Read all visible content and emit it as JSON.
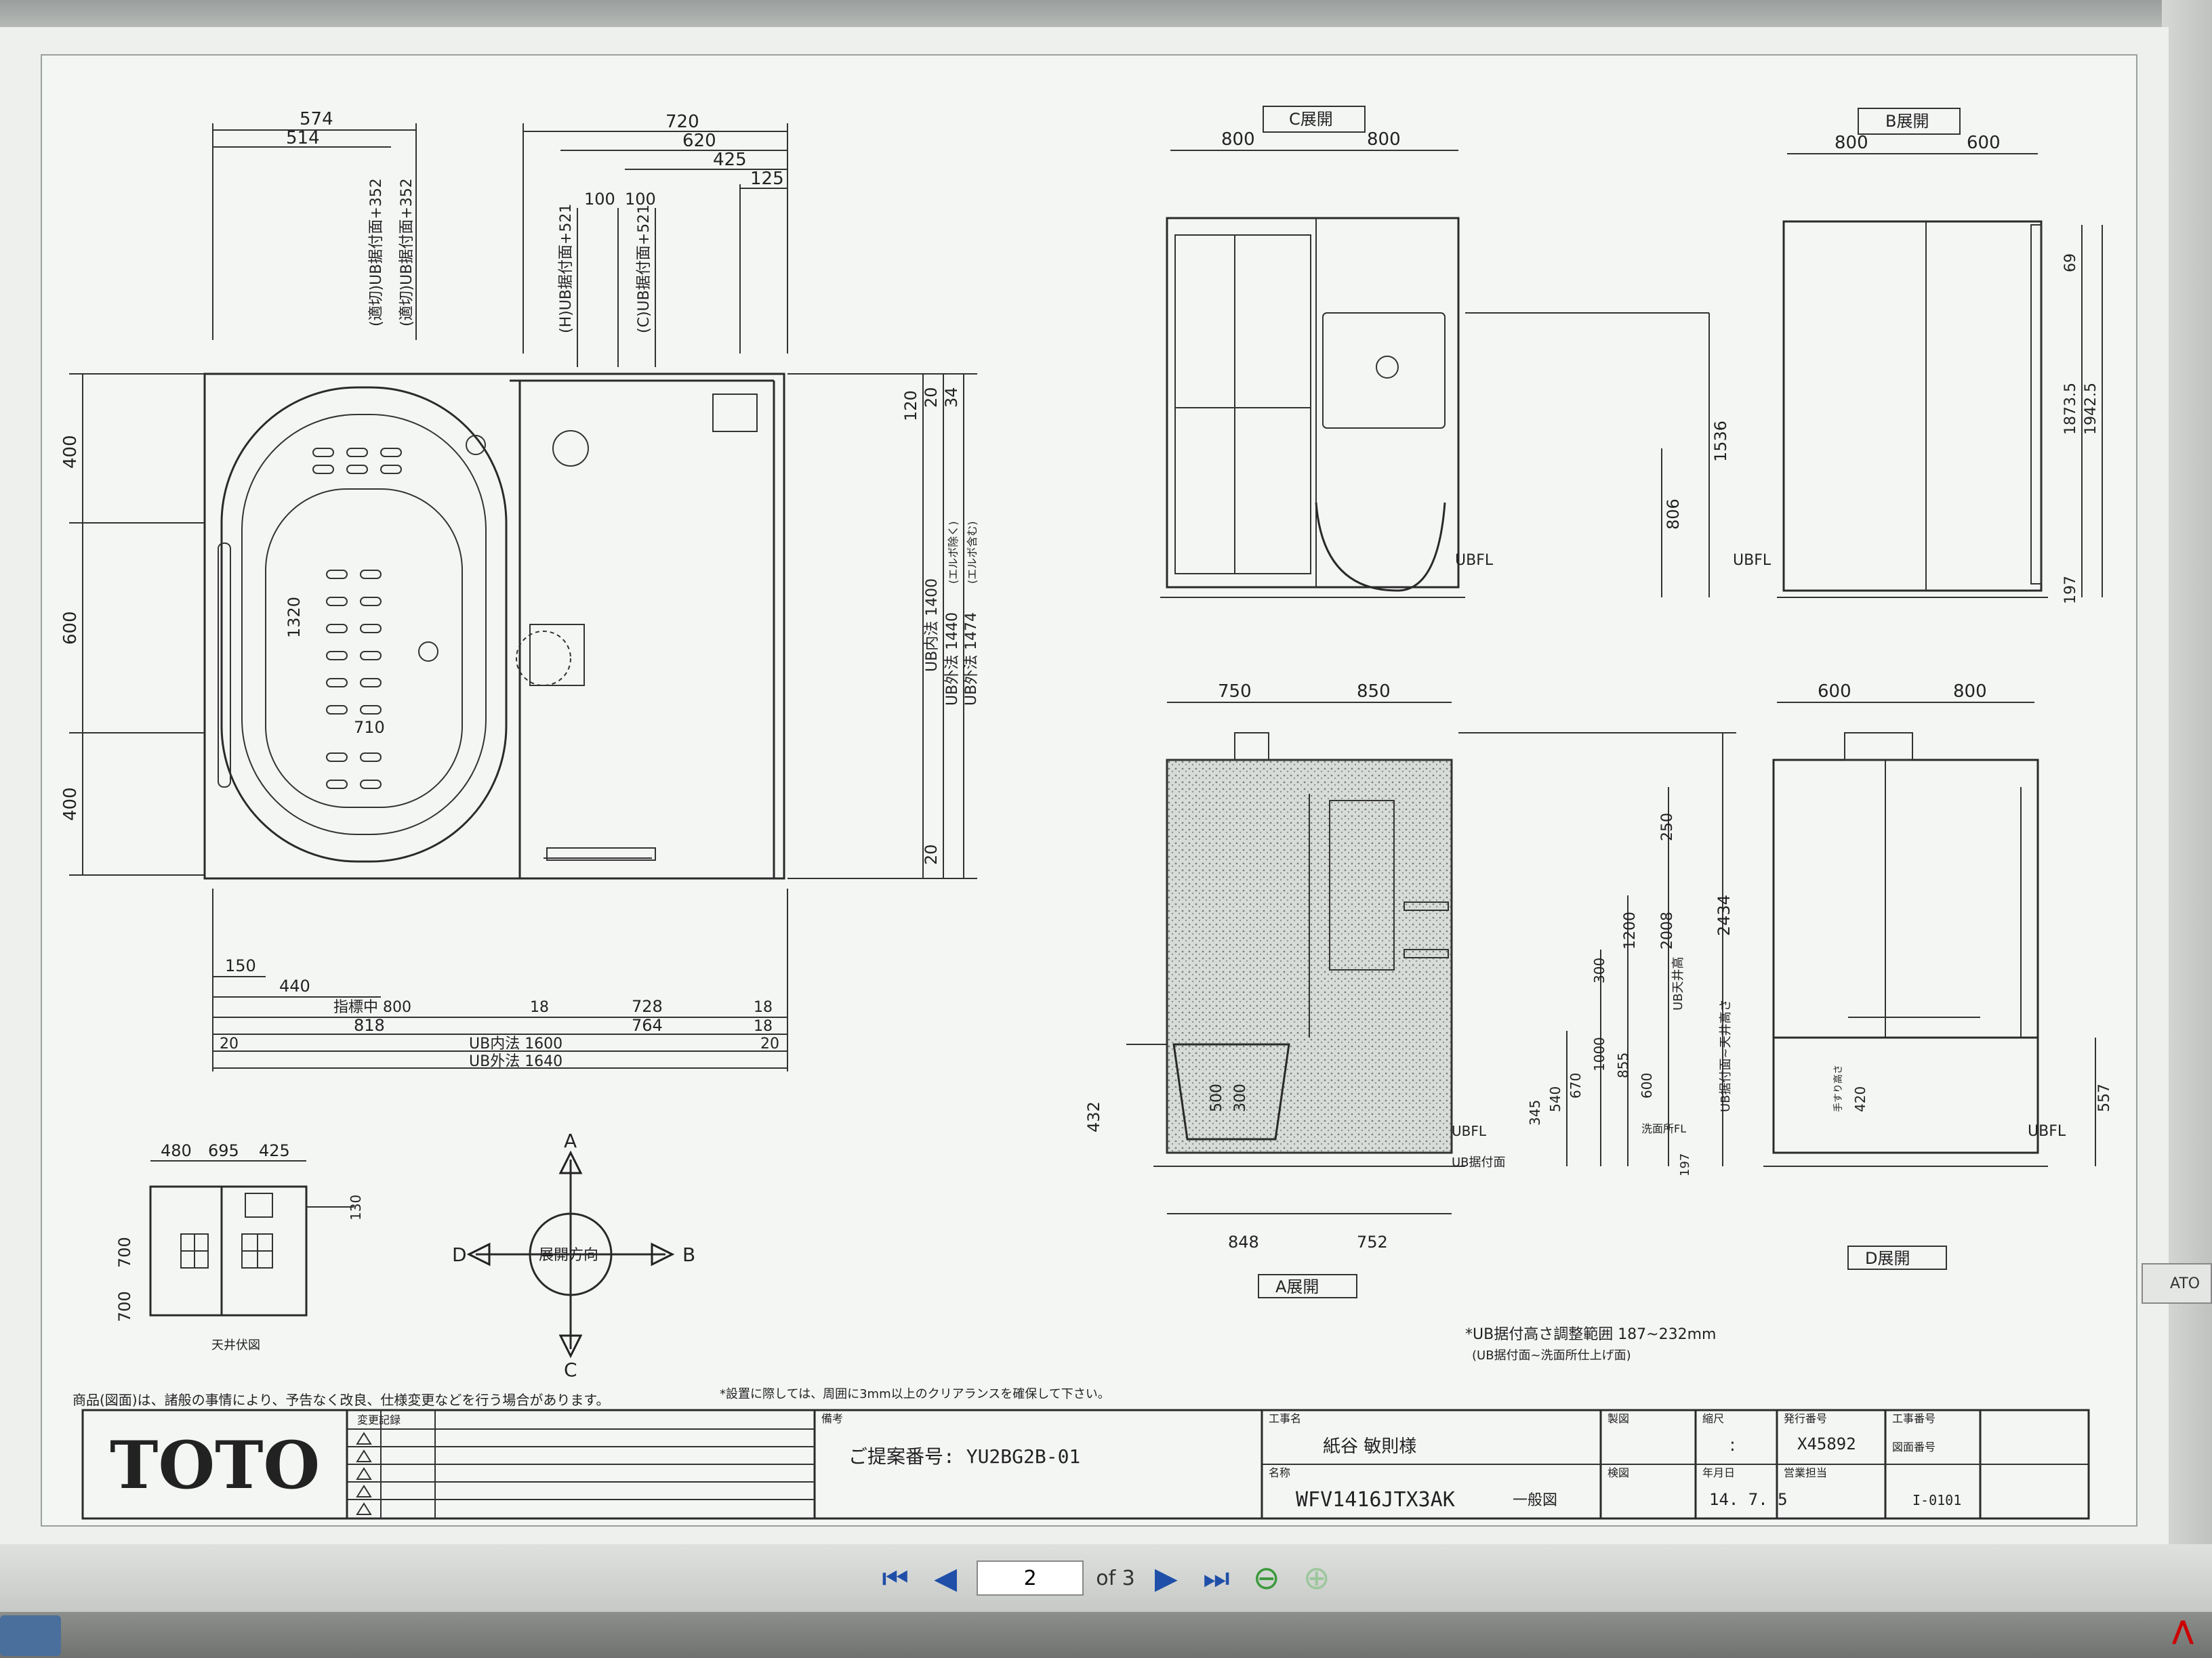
{
  "viewer": {
    "page_current": "2",
    "page_total_label": "of 3",
    "side_tab_label": "ATO"
  },
  "icons": {
    "first": "first-page-icon",
    "prev": "prev-page-icon",
    "next": "next-page-icon",
    "last": "last-page-icon",
    "back": "back-icon",
    "forward": "forward-icon"
  },
  "drawing": {
    "plan_dims_top": [
      "574",
      "514",
      "720",
      "620",
      "425",
      "125",
      "100",
      "100"
    ],
    "plan_vertical_labels": [
      "(適切)UB据付面+352",
      "(適切)UB据付面+352",
      "(H)UB据付面+521",
      "(C)UB据付面+521"
    ],
    "plan_dims_left": [
      "400",
      "600",
      "400"
    ],
    "plan_dims_right": [
      "120",
      "20",
      "34",
      "20"
    ],
    "plan_inner": [
      "1320",
      "710"
    ],
    "plan_ub_labels": [
      "UB内法 1400",
      "UB外法 1440",
      "UB外法 1474"
    ],
    "plan_ub_notes": [
      "(エルボ除く)",
      "(エルボ含む)"
    ],
    "plan_dims_bottom": [
      "150",
      "440",
      "指標中 800",
      "818",
      "18",
      "728",
      "764",
      "18",
      "18",
      "20",
      "UB内法 1600",
      "UB外法 1640",
      "20"
    ],
    "ceiling": {
      "dims": [
        "480",
        "695",
        "425",
        "700",
        "700",
        "130"
      ],
      "label": "天井伏図"
    },
    "compass": {
      "A": "A",
      "B": "B",
      "C": "C",
      "D": "D",
      "center": "展開方向"
    },
    "elev_c": {
      "label": "C展開",
      "dims": [
        "800",
        "800",
        "1536",
        "806"
      ],
      "floor": "UBFL"
    },
    "elev_b": {
      "label": "B展開",
      "dims": [
        "800",
        "600",
        "69",
        "1873.5",
        "1942.5",
        "197"
      ],
      "floor": "UBFL"
    },
    "elev_a": {
      "label": "A展開",
      "dims_top": [
        "750",
        "850"
      ],
      "dims_bottom": [
        "848",
        "752"
      ],
      "dims_right": [
        "250",
        "1200",
        "2008",
        "2434",
        "300",
        "1000",
        "855",
        "600",
        "670",
        "540",
        "345",
        "432",
        "500",
        "300",
        "197"
      ],
      "vertical_labels": [
        "UB天井高",
        "UB据付面~天井高さ"
      ],
      "floor_labels": [
        "UBFL",
        "UB据付面",
        "洗面所FL"
      ]
    },
    "elev_d": {
      "label": "D展開",
      "dims": [
        "600",
        "800",
        "557",
        "420"
      ],
      "floor": "UBFL",
      "note": "手すり高さ"
    },
    "note_adjust": "*UB据付高さ調整範囲 187~232mm",
    "note_adjust_sub": "(UB据付面~洗面所仕上げ面)",
    "notice_left": "商品(図面)は、諸般の事情により、予告なく改良、仕様変更などを行う場合があります。",
    "notice_right": "*設置に際しては、周囲に3mm以上のクリアランスを確保して下さい。"
  },
  "titleblock": {
    "logo": "TOTO",
    "revision_header": "変更記録",
    "remarks_header": "備考",
    "proposal": "ご提案番号: YU2BG2B-01",
    "project_header": "工事名",
    "project_name": "紙谷  敏則様",
    "name_header": "名称",
    "product": "WFV1416JTX3AK",
    "drawing_type": "一般図",
    "draw_header": "製図",
    "check_header": "検図",
    "scale_header": "縮尺",
    "scale_value": ":",
    "date_header": "年月日",
    "date_value": "14. 7. 5",
    "issue_header": "発行番号",
    "issue_value": "X45892",
    "sales_header": "営業担当",
    "work_no_header": "工事番号",
    "drawing_no_header": "図面番号",
    "drawing_no": "I-0101"
  }
}
